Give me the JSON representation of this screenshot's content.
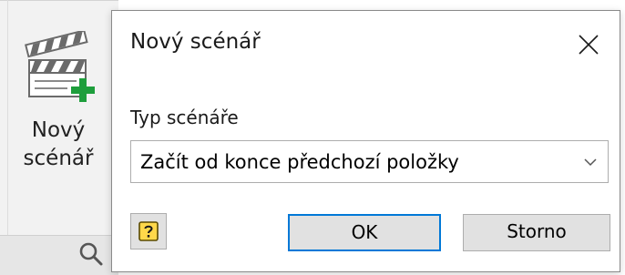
{
  "ribbon": {
    "new_scenario_button": {
      "label": "Nový\nscénář",
      "icon": "clapperboard-add-icon"
    },
    "search_icon": "search-icon"
  },
  "dialog": {
    "title": "Nový scénář",
    "close_icon": "close-icon",
    "scenario_type": {
      "label": "Typ scénáře",
      "selected": "Začít od konce předchozí položky"
    },
    "help_icon": "help-icon",
    "ok_label": "OK",
    "cancel_label": "Storno"
  },
  "colors": {
    "accent": "#0078d7",
    "button_face": "#e1e1e1",
    "add_badge": "#1e9e3c",
    "help_icon": "#d4a300"
  }
}
